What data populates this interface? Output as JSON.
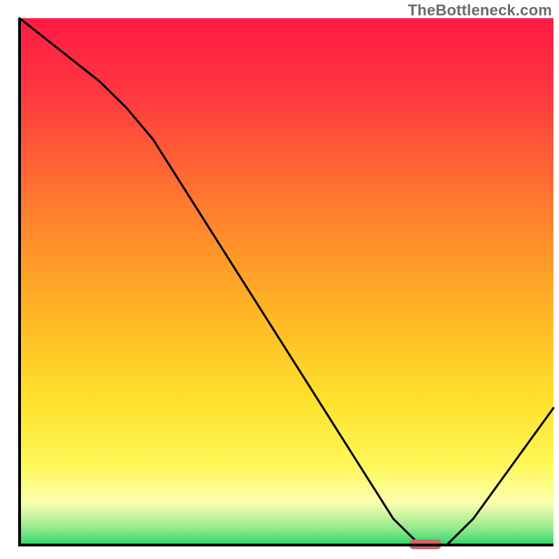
{
  "watermark": "TheBottleneck.com",
  "chart_data": {
    "type": "line",
    "title": "",
    "xlabel": "",
    "ylabel": "",
    "xlim": [
      0,
      100
    ],
    "ylim": [
      0,
      100
    ],
    "series": [
      {
        "name": "bottleneck-curve",
        "x": [
          0,
          5,
          10,
          15,
          20,
          25,
          30,
          35,
          40,
          45,
          50,
          55,
          60,
          65,
          70,
          75,
          80,
          85,
          90,
          95,
          100
        ],
        "y": [
          100,
          96,
          92,
          88,
          83,
          77,
          69,
          61,
          53,
          45,
          37,
          29,
          21,
          13,
          5,
          0,
          0,
          5,
          12,
          19,
          26
        ]
      }
    ],
    "marker": {
      "name": "optimal-range",
      "x_start": 73,
      "x_end": 79,
      "y": 0,
      "color": "#c96a6a"
    },
    "gradient_bands": [
      {
        "stop": 0.0,
        "color": "#ff1a44"
      },
      {
        "stop": 0.15,
        "color": "#ff3a3f"
      },
      {
        "stop": 0.35,
        "color": "#ff7a2e"
      },
      {
        "stop": 0.55,
        "color": "#ffb326"
      },
      {
        "stop": 0.72,
        "color": "#ffe02a"
      },
      {
        "stop": 0.85,
        "color": "#fff85a"
      },
      {
        "stop": 0.92,
        "color": "#fbffb0"
      },
      {
        "stop": 0.97,
        "color": "#8fe98c"
      },
      {
        "stop": 1.0,
        "color": "#2fd36a"
      }
    ],
    "axes_color": "#000000"
  }
}
